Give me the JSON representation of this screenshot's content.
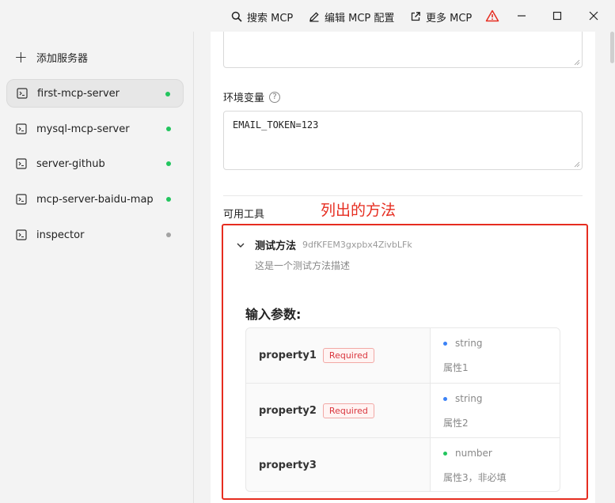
{
  "titlebar": {
    "search_label": "搜索 MCP",
    "edit_label": "编辑 MCP 配置",
    "more_label": "更多 MCP",
    "warning_color": "#e62d20"
  },
  "sidebar": {
    "add_label": "添加服务器",
    "servers": [
      {
        "name": "first-mcp-server",
        "status_color": "#22c55e",
        "active": true
      },
      {
        "name": "mysql-mcp-server",
        "status_color": "#22c55e",
        "active": false
      },
      {
        "name": "server-github",
        "status_color": "#22c55e",
        "active": false
      },
      {
        "name": "mcp-server-baidu-map",
        "status_color": "#22c55e",
        "active": false
      },
      {
        "name": "inspector",
        "status_color": "#a3a3a3",
        "active": false
      }
    ]
  },
  "main": {
    "env_label": "环境变量",
    "env_help": "?",
    "env_value": "EMAIL_TOKEN=123",
    "tools_label": "可用工具",
    "annotation": "列出的方法",
    "tool": {
      "name": "测试方法",
      "id": "9dfKFEM3gxpbx4ZivbLFk",
      "description": "这是一个测试方法描述",
      "params_title": "输入参数:",
      "params": [
        {
          "name": "property1",
          "required": true,
          "required_label": "Required",
          "type": "string",
          "type_color": "#3b82f6",
          "description": "属性1"
        },
        {
          "name": "property2",
          "required": true,
          "required_label": "Required",
          "type": "string",
          "type_color": "#3b82f6",
          "description": "属性2"
        },
        {
          "name": "property3",
          "required": false,
          "required_label": "",
          "type": "number",
          "type_color": "#22c55e",
          "description": "属性3，非必填"
        }
      ]
    }
  }
}
